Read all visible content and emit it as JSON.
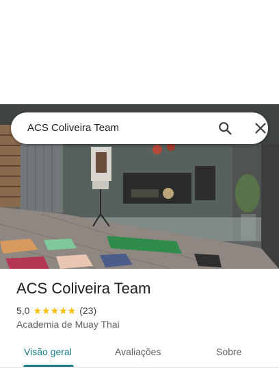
{
  "search": {
    "query": "ACS Coliveira Team",
    "search_icon": "search-icon",
    "clear_icon": "close-icon"
  },
  "place": {
    "name": "ACS Coliveira Team",
    "rating": "5,0",
    "stars_glyphs": "★★★★★",
    "review_count": "(23)",
    "category": "Academia de Muay Thai",
    "star_color": "#fbbc04"
  },
  "tabs": [
    {
      "label": "Visão geral",
      "active": true
    },
    {
      "label": "Avaliações",
      "active": false
    },
    {
      "label": "Sobre",
      "active": false
    }
  ],
  "accent_color": "#1a7f8a"
}
